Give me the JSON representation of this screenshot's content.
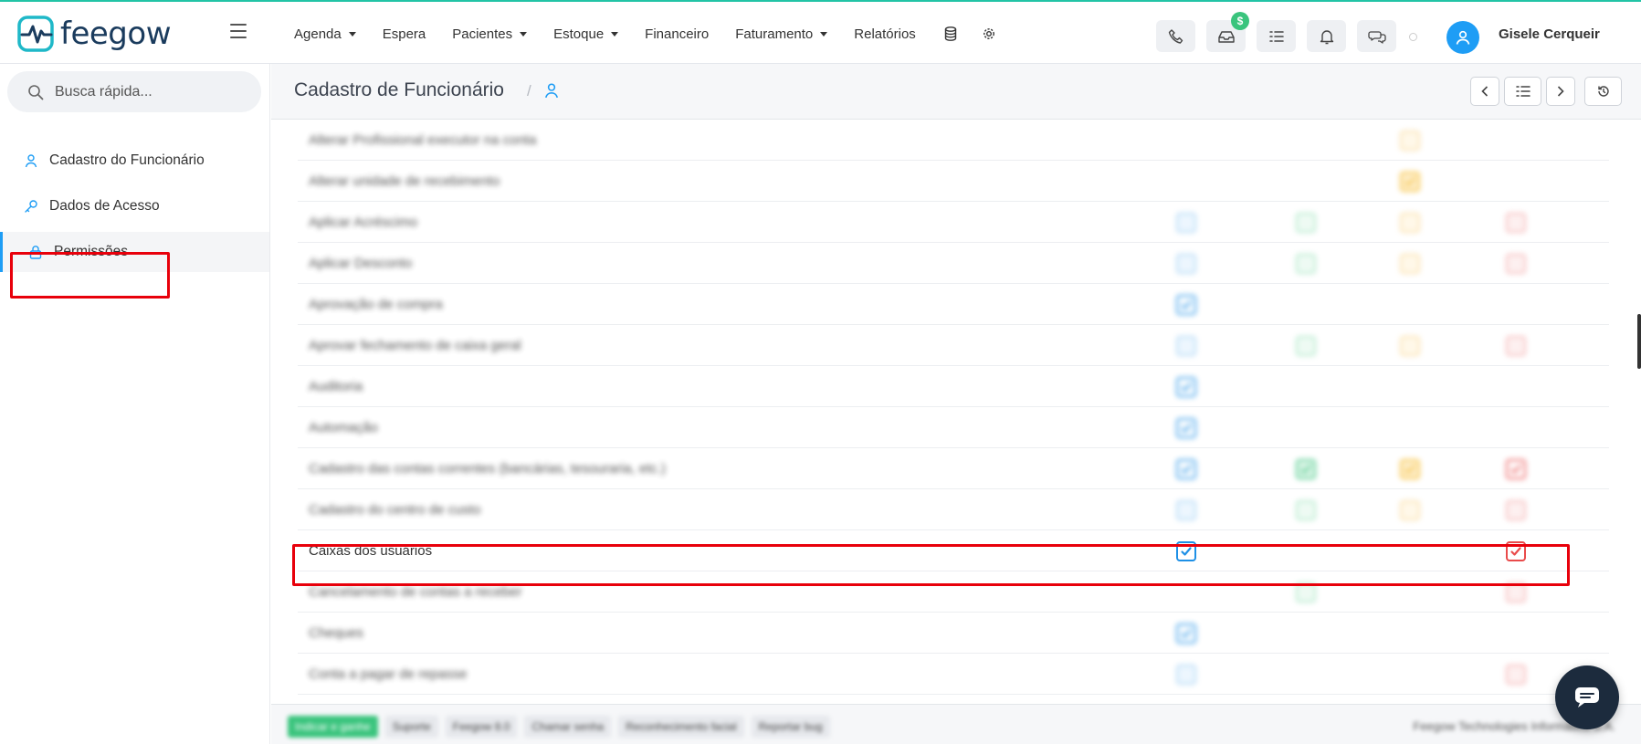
{
  "brand": {
    "name": "feegow",
    "accent": "#22c4a6",
    "primary": "#1e9df5"
  },
  "nav": {
    "items": [
      {
        "label": "Agenda",
        "dropdown": true
      },
      {
        "label": "Espera",
        "dropdown": false
      },
      {
        "label": "Pacientes",
        "dropdown": true
      },
      {
        "label": "Estoque",
        "dropdown": true
      },
      {
        "label": "Financeiro",
        "dropdown": false
      },
      {
        "label": "Faturamento",
        "dropdown": true
      },
      {
        "label": "Relatórios",
        "dropdown": false
      }
    ],
    "icons": [
      "database-icon",
      "gear-icon"
    ]
  },
  "toolbar": {
    "buttons": [
      "phone-icon",
      "inbox-icon",
      "tasks-icon",
      "bell-icon",
      "chat-icon"
    ],
    "inbox_badge": "$"
  },
  "user": {
    "name": "Gisele Cerqueir"
  },
  "sidebar": {
    "search_placeholder": "Busca rápida...",
    "items": [
      {
        "label": "Cadastro do Funcionário",
        "icon": "user-icon",
        "active": false
      },
      {
        "label": "Dados de Acesso",
        "icon": "key-icon",
        "active": false
      },
      {
        "label": "Permissões",
        "icon": "lock-icon",
        "active": true
      }
    ]
  },
  "header": {
    "title": "Cadastro de Funcionário",
    "breadcrumb_icon": "user-icon"
  },
  "permissions": {
    "rows": [
      {
        "label": "Alterar Profissional executor na conta",
        "blurred": true,
        "cells": [
          null,
          null,
          "yellow",
          null
        ]
      },
      {
        "label": "Alterar unidade de recebimento",
        "blurred": true,
        "cells": [
          null,
          null,
          "yellow-checked",
          null
        ]
      },
      {
        "label": "Aplicar Acréscimo",
        "blurred": true,
        "cells": [
          "blue",
          "green",
          "yellow",
          "red"
        ]
      },
      {
        "label": "Aplicar Desconto",
        "blurred": true,
        "cells": [
          "blue",
          "green",
          "yellow",
          "red"
        ]
      },
      {
        "label": "Aprovação de compra",
        "blurred": true,
        "cells": [
          "blue-checked",
          null,
          null,
          null
        ]
      },
      {
        "label": "Aprovar fechamento de caixa geral",
        "blurred": true,
        "cells": [
          "blue",
          "green",
          "yellow",
          "red"
        ]
      },
      {
        "label": "Auditoria",
        "blurred": true,
        "cells": [
          "blue-checked",
          null,
          null,
          null
        ]
      },
      {
        "label": "Automação",
        "blurred": true,
        "cells": [
          "blue-checked",
          null,
          null,
          null
        ]
      },
      {
        "label": "Cadastro das contas correntes (bancárias, tesouraria, etc.)",
        "blurred": true,
        "cells": [
          "blue-checked",
          "green-checked",
          "yellow-checked",
          "red-checked"
        ]
      },
      {
        "label": "Cadastro do centro de custo",
        "blurred": true,
        "cells": [
          "blue",
          "green",
          "yellow",
          "red"
        ]
      },
      {
        "label": "Caixas dos usuários",
        "blurred": false,
        "cells": [
          "blue-checked",
          null,
          null,
          "red-checked"
        ]
      },
      {
        "label": "Cancelamento de contas a receber",
        "blurred": true,
        "cells": [
          null,
          "green",
          null,
          "red"
        ]
      },
      {
        "label": "Cheques",
        "blurred": true,
        "cells": [
          "blue-checked",
          null,
          null,
          null
        ]
      },
      {
        "label": "Conta a pagar de repasse",
        "blurred": true,
        "cells": [
          "blue",
          null,
          null,
          "red"
        ]
      }
    ]
  },
  "footer": {
    "buttons": [
      "Indicar e ganhe",
      "Suporte",
      "Feegow 8.0",
      "Chamar senha",
      "Reconhecimento facial",
      "Reportar bug"
    ],
    "copyright": "Feegow Technologies Informática S.A."
  }
}
